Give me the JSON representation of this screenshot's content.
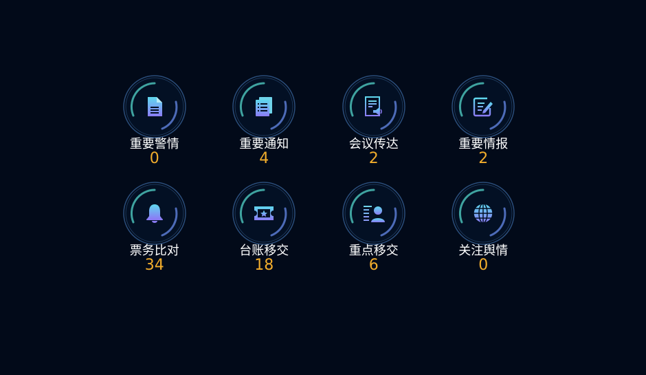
{
  "colors": {
    "background": "#020a19",
    "label": "#ffffff",
    "count": "#f2ad2c",
    "ring_outer": "#2a4d7a",
    "arc_teal": "#3fa3a0",
    "arc_blue": "#4d6bb8"
  },
  "tiles": [
    {
      "label": "重要警情",
      "count": "0",
      "icon": "document-icon"
    },
    {
      "label": "重要通知",
      "count": "4",
      "icon": "notice-list-icon"
    },
    {
      "label": "会议传达",
      "count": "2",
      "icon": "meeting-broadcast-icon"
    },
    {
      "label": "重要情报",
      "count": "2",
      "icon": "edit-report-icon"
    },
    {
      "label": "票务比对",
      "count": "34",
      "icon": "bell-icon"
    },
    {
      "label": "台账移交",
      "count": "18",
      "icon": "ticket-star-icon"
    },
    {
      "label": "重点移交",
      "count": "6",
      "icon": "person-list-icon"
    },
    {
      "label": "关注舆情",
      "count": "0",
      "icon": "globe-icon"
    }
  ]
}
